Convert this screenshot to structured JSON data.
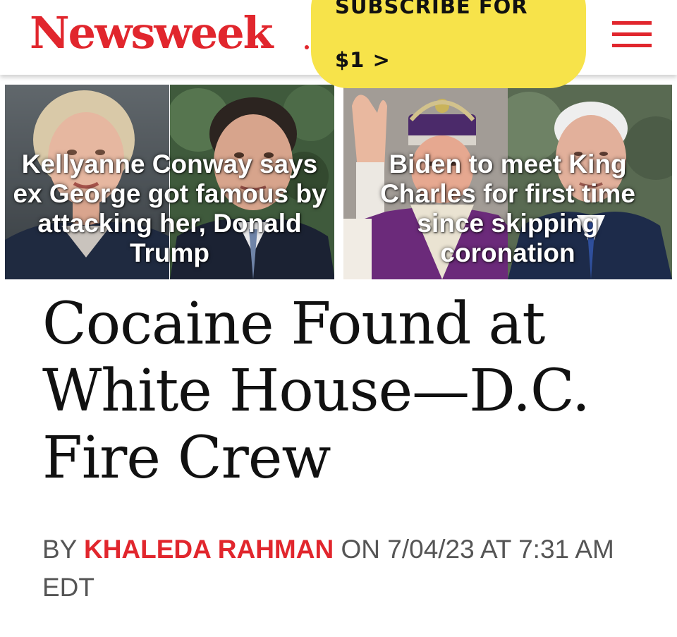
{
  "header": {
    "logo_text": "Newsweek",
    "subscribe": {
      "line1": "SUBSCRIBE FOR",
      "line2": "$1  >"
    },
    "menu_icon": "hamburger-menu-icon"
  },
  "stories": [
    {
      "title": "Kellyanne Conway says ex George got famous by attacking her, Donald Trump"
    },
    {
      "title": "Biden to meet King Charles for first time since skipping coronation"
    }
  ],
  "article": {
    "headline": "Cocaine Found at White House—D.C. Fire Crew",
    "byline": {
      "prefix": "BY",
      "author": "KHALEDA RAHMAN",
      "date_text": "ON 7/04/23 AT 7:31 AM EDT"
    }
  },
  "colors": {
    "brand_red": "#e1262d",
    "subscribe_yellow": "#f7e34a",
    "headline_text": "#111111",
    "byline_text": "#555555"
  }
}
